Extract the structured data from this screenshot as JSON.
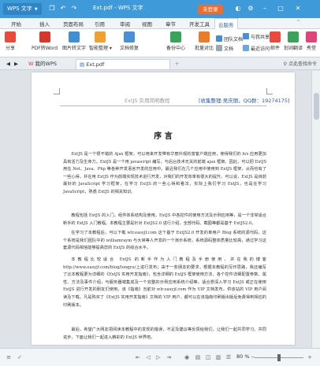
{
  "titlebar": {
    "app_menu": "WPS 文字",
    "window_title": "Ext.pdf - WPS 文字",
    "login": "未登录"
  },
  "ribbon": {
    "tabs": [
      "开始",
      "插入",
      "页面布局",
      "引用",
      "审阅",
      "视图",
      "章节",
      "开发工具",
      "云服务"
    ],
    "active_tab_index": 8
  },
  "toolbar": {
    "share": "分享",
    "pdf_to_word": "PDF转Word",
    "image_to_text": "图片转文字",
    "smart_org": "智能整理",
    "doc_repair": "文档修复",
    "backup": "备份中心",
    "batch_compare": "批量对比",
    "word_count": "文档",
    "team_doc": "团队文档",
    "with_share": "与我共享",
    "recent": "最近访问",
    "mail": "邮件",
    "draw": "划词翻译",
    "xiu": "秀堂"
  },
  "doc_tabs": {
    "home": "我的WPS",
    "file": "Ext.pdf",
    "search_hint": "点此查找命令"
  },
  "document": {
    "header_left": "ExtJS 实用简明教程",
    "header_right": "[收集整理:吴庆丽，QQ群：19274175]",
    "title": "序  言",
    "p1": "ExtJS 是一个很不错的 Ajax 框架，可以用来开发带有华丽外观的富客户端应用，使得我们的 b/s 应用更加具有活力及生命力。ExtJS 是一个用 javascript 编写，与后台技术无关的前端 ajax 框架。因此，可以把 ExtJS 用在.Net、Java、Php 等各种开发语言开发的应用中。最近我们在几个应用中使用到 ExtJS 框架，从而也有了一些心得，并在用 ExtJS 作为前端实现技术进行开发，对我们的开发效率有很大的提升。可以说，ExtJS 是目前最好的 JavaScript 学习框架，在学习 ExtJS 的一些心得和看法，实际上我们学习 ExtJS，也是在学习 JavaScript，熟悉 ExtJS 的相关知识。",
    "p2": "教程包括 ExtJS 的入门，组件体系结构及使用，ExtJS 中各控件的使用方法及示例应用等，是一个非常适合新手的 ExtJS 入门教程。本教程主要是针对 ExtJS2.0 进行介绍，全部代码、截图等都是基于 ExtJS2.0。",
    "p3": "在学习了本教程后，可以下载 wlr.easyjf.com 这个基于 ExtJS2.0 开发的单用户 Blog 系统的源代码，这个系统是我们团队中的 williamraym 与大峡等人开发的一个演示系统，系统源码整体质量比较高，通过学习这套源代码相信能够提高您的 ExtJS 的综合水平。",
    "p4": "本教程比较适合 ExtJS 的新手作为入门教程及手册使用，并在我的博客 http://www.easyjf.com/blog/lengyu/上进行发布；由于一些朋友的要求，根据本教程的写作思路，我还编写了比本教程更为详细的《ExtJS 实用开发指南》，包含详细的 ExtJS 框架使用方法、各个控件详细配置参数、属性、方法及事件介绍，与服务器端集成及一个完整的示例应用系统介绍等。适合想深入学习 ExtJS 或正在使用 ExtJS 进行开发的朋友们使用。该《指南》当前对 wlr.easyjf.com 作为 VIP 文档发布，供该站的 VIP 用户阅读及下载。凡是购买了《ExtJS 实用开发指南》文档的 VIP 用户，都可以在该指南印刷版出版后免费得到相应的印刷版本。",
    "p5": "最后，希望广大网友把阅读本教程中的发现的错误、不足及建议等反馈给我们，让我们一起共同学习、共同进步，下面让我们一起进入精彩的 ExtJS 世界吧。"
  },
  "statusbar": {
    "zoom": "80 %",
    "zoom_level_fraction": 0.5
  },
  "colors": {
    "titlebar": "#3f9ad9",
    "login": "#f06c2a",
    "accent": "#2a6fb3"
  }
}
